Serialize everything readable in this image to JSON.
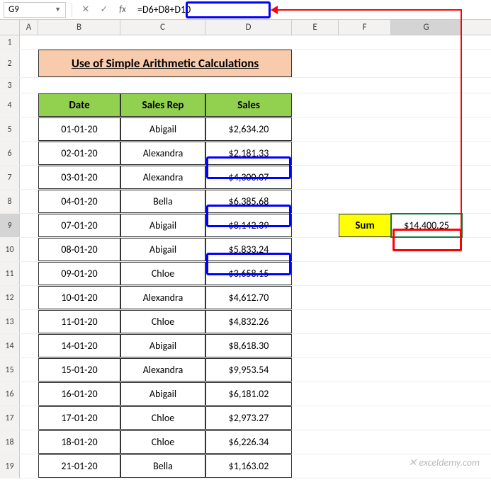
{
  "nameBox": "G9",
  "formula": "=D6+D8+D10",
  "columns": [
    "A",
    "B",
    "C",
    "D",
    "E",
    "F",
    "G"
  ],
  "rows": [
    "1",
    "2",
    "3",
    "4",
    "5",
    "6",
    "7",
    "8",
    "9",
    "10",
    "11",
    "12",
    "13",
    "14",
    "15",
    "16",
    "17",
    "18",
    "19"
  ],
  "title": "Use of Simple Arithmetic Calculations",
  "headers": {
    "date": "Date",
    "rep": "Sales Rep",
    "sales": "Sales"
  },
  "data": [
    {
      "date": "01-01-20",
      "rep": "Abigail",
      "sales": "$2,634.20"
    },
    {
      "date": "02-01-20",
      "rep": "Alexandra",
      "sales": "$2,181.33"
    },
    {
      "date": "03-01-20",
      "rep": "Alexandra",
      "sales": "$4,300.07"
    },
    {
      "date": "04-01-20",
      "rep": "Bella",
      "sales": "$6,385.68"
    },
    {
      "date": "07-01-20",
      "rep": "Abigail",
      "sales": "$8,142.39"
    },
    {
      "date": "08-01-20",
      "rep": "Abigail",
      "sales": "$5,833.24"
    },
    {
      "date": "09-01-20",
      "rep": "Chloe",
      "sales": "$3,658.15"
    },
    {
      "date": "10-01-20",
      "rep": "Alexandra",
      "sales": "$4,612.70"
    },
    {
      "date": "11-01-20",
      "rep": "Chloe",
      "sales": "$4,832.26"
    },
    {
      "date": "14-01-20",
      "rep": "Abigail",
      "sales": "$8,618.30"
    },
    {
      "date": "15-01-20",
      "rep": "Alexandra",
      "sales": "$9,953.54"
    },
    {
      "date": "16-01-20",
      "rep": "Abigail",
      "sales": "$6,181.02"
    },
    {
      "date": "17-01-20",
      "rep": "Chloe",
      "sales": "$2,973.27"
    },
    {
      "date": "18-01-20",
      "rep": "Chloe",
      "sales": "$6,226.34"
    },
    {
      "date": "21-01-20",
      "rep": "Bella",
      "sales": "$1,163.02"
    }
  ],
  "sumLabel": "Sum",
  "sumValue": "$14,400.25",
  "watermark": "✕ exceldemy.com"
}
